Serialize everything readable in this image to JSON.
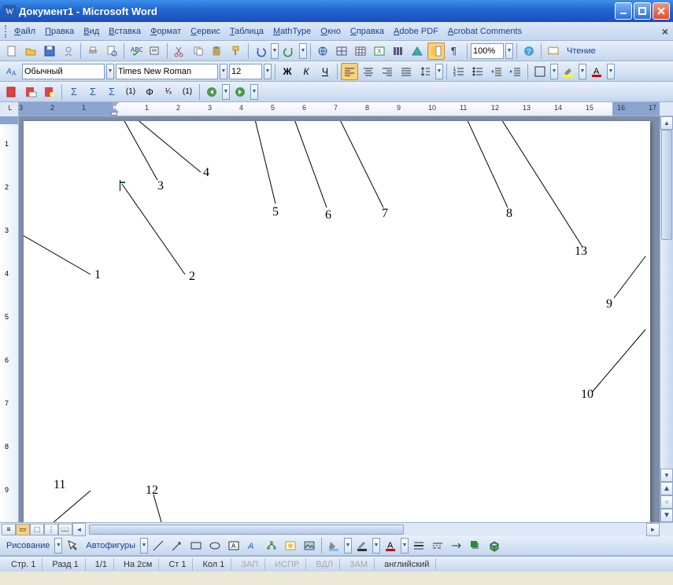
{
  "title": "Документ1 - Microsoft Word",
  "menus": [
    "Файл",
    "Правка",
    "Вид",
    "Вставка",
    "Формат",
    "Сервис",
    "Таблица",
    "MathType",
    "Окно",
    "Справка",
    "Adobe PDF",
    "Acrobat Comments"
  ],
  "menu_underline": [
    "Ф",
    "П",
    "В",
    "В",
    "Ф",
    "С",
    "Т",
    "M",
    "О",
    "С",
    "P",
    "C"
  ],
  "toolbar1": {
    "zoom": "100%",
    "read_mode": "Чтение"
  },
  "toolbar2": {
    "style_label": "Обычный",
    "font": "Times New Roman",
    "size": "12"
  },
  "drawing": {
    "label": "Рисование",
    "autoshapes": "Автофигуры"
  },
  "status": {
    "page": "Стр. 1",
    "section": "Разд 1",
    "pages": "1/1",
    "at": "На 2см",
    "line": "Ст 1",
    "col": "Кол 1",
    "rec": "ЗАП",
    "trk": "ИСПР",
    "ext": "ВДЛ",
    "ovr": "ЗАМ",
    "lang": "английский"
  },
  "annotations": [
    "1",
    "2",
    "3",
    "4",
    "5",
    "6",
    "7",
    "8",
    "9",
    "10",
    "11",
    "12",
    "13"
  ],
  "ruler_numbers": [
    "3",
    "2",
    "1",
    "1",
    "2",
    "3",
    "4",
    "5",
    "6",
    "7",
    "8",
    "9",
    "10",
    "11",
    "12",
    "13",
    "14",
    "15",
    "16",
    "17"
  ],
  "vruler_numbers": [
    "1",
    "2",
    "3",
    "4",
    "5",
    "6",
    "7",
    "8",
    "9"
  ]
}
